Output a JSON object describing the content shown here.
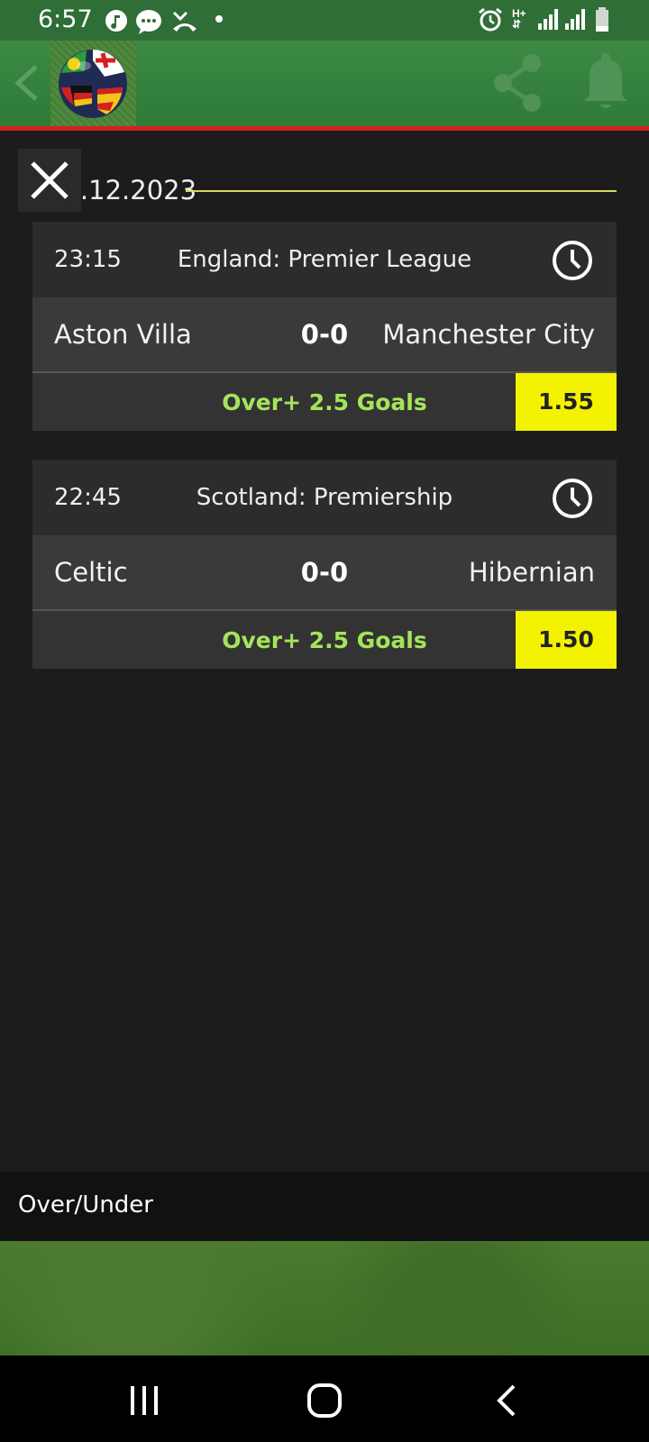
{
  "status_bar": {
    "time": "6:57",
    "left_icons": [
      "music-icon",
      "chat-icon",
      "missed-call-icon",
      "dot-icon"
    ],
    "right_icons": [
      "alarm-icon",
      "hplus-data-icon",
      "signal-icon",
      "signal-icon",
      "battery-icon"
    ],
    "network_label": "H+"
  },
  "app_bar": {
    "icons": [
      "back-arrow-icon",
      "football-flags-logo",
      "share-icon",
      "bell-icon"
    ]
  },
  "date_section": {
    "date": "06.12.2023"
  },
  "matches": [
    {
      "time": "23:15",
      "league": "England: Premier League",
      "home": "Aston Villa",
      "score": "0-0",
      "away": "Manchester City",
      "tip": "Over+ 2.5 Goals",
      "odds": "1.55"
    },
    {
      "time": "22:45",
      "league": "Scotland: Premiership",
      "home": "Celtic",
      "score": "0-0",
      "away": "Hibernian",
      "tip": "Over+ 2.5 Goals",
      "odds": "1.50"
    }
  ],
  "footer": {
    "label": "Over/Under"
  },
  "colors": {
    "status_bar": "#2f6e36",
    "app_bar": "#3c8a44",
    "accent_line": "#d32121",
    "tip_text": "#a4e45a",
    "odds_bg": "#f3f300",
    "date_line": "#d8d85a"
  },
  "nav_bar": {
    "icons": [
      "recent-apps-icon",
      "home-icon",
      "back-icon"
    ]
  }
}
